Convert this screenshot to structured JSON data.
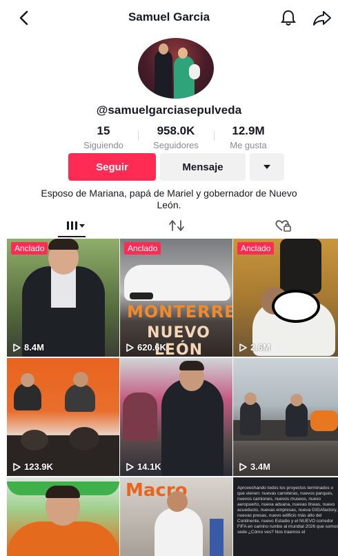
{
  "header": {
    "title": "Samuel Garcia",
    "back_icon": "back-chevron-icon",
    "bell_icon": "bell-icon",
    "share_icon": "share-icon"
  },
  "profile": {
    "handle": "@samuelgarciasepulveda",
    "stats": [
      {
        "value": "15",
        "label": "Siguiendo"
      },
      {
        "value": "958.0K",
        "label": "Seguidores"
      },
      {
        "value": "12.9M",
        "label": "Me gusta"
      }
    ],
    "follow_label": "Seguir",
    "message_label": "Mensaje",
    "bio": "Esposo de Mariana, papá de Mariel y gobernador de Nuevo León."
  },
  "tabs": [
    {
      "name": "videos",
      "icon": "grid-icon"
    },
    {
      "name": "reposts",
      "icon": "repost-icon"
    },
    {
      "name": "liked",
      "icon": "liked-hidden-icon"
    }
  ],
  "videos": [
    {
      "pinned": "Anclado",
      "views": "8.4M"
    },
    {
      "pinned": "Anclado",
      "views": "620.6K",
      "overlay_line1": "MONTERREY",
      "overlay_line2": "NUEVO LEÓN"
    },
    {
      "pinned": "Anclado",
      "views": "2.6M"
    },
    {
      "views": "123.9K"
    },
    {
      "views": "14.1K"
    },
    {
      "views": "3.4M"
    },
    {},
    {
      "overlay_text": "Macro"
    },
    {
      "overlay_text": "Aprovechando todos los proyectos terminados o que vienen: nuevas carreteras, nuevos parques, nuevos camiones, nuevos museos, nuevo aeropuerto, nueva aduana, nuevas líneas, nuevo acueducto, nuevas empresas, nueva GIGAfactory, nuevas presas, nuevo edificio más alto del Continente, nuevo Estadio y el NUEVO corredor FIFA en camino rumbo al mundial 2026 que somos sede ¿Cómo ves? Nos traemos el"
    }
  ],
  "colors": {
    "accent": "#fe2c55",
    "secondary_button": "#f1f1f2",
    "text": "#161823",
    "muted_text": "#8a8b91"
  }
}
